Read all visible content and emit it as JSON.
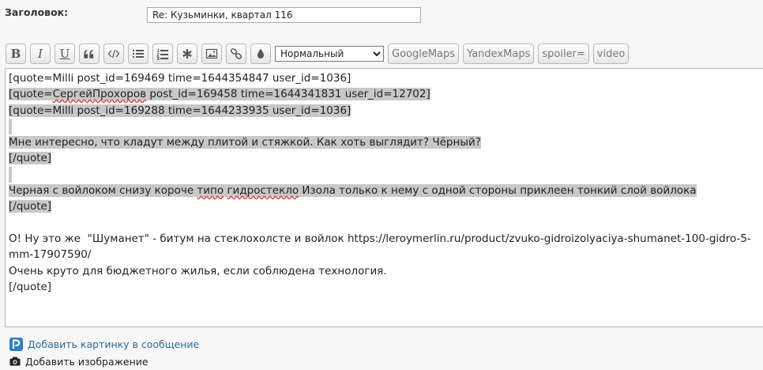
{
  "subject": {
    "label": "Заголовок:",
    "value": "Re: Кузьминки, квартал 116"
  },
  "toolbar": {
    "bold_label": "B",
    "italic_label": "I",
    "underline_label": "U",
    "quote_label": "❝",
    "code_icon": "code-icon",
    "font_select_value": "Нормальный",
    "googlemaps_label": "GoogleMaps",
    "yandexmaps_label": "YandexMaps",
    "spoiler_label": "spoiler=",
    "video_label": "video"
  },
  "editor": {
    "l1": "[quote=Milli post_id=169469 time=1644354847 user_id=1036]",
    "l2a": "[quote=",
    "l2b": "СергейПрохоров",
    "l2c": " post_id=169458 time=1644341831 user_id=12702]",
    "l3": "[quote=Milli post_id=169288 time=1644233935 user_id=1036]",
    "l5": "Мне интересно, что кладут между плитой и стяжкой. Как хоть выглядит? Чёрный?",
    "l6": "[/quote]",
    "l8a": "Черная с войлоком снизу короче ",
    "l8b": "типо",
    "l8c": " ",
    "l8d": "гидростекло",
    "l8e": " Изола только к нему с одной стороны приклеен тонкий слой войлока",
    "l9": "[/quote]",
    "l11": "О! Ну это же  \"Шуманет\" - битум на стеклохолсте и войлок https://leroymerlin.ru/product/zvuko-gidroizolyaciya-shumanet-100-gidro-5-mm-17907590/",
    "l12": "Очень круто для бюджетного жилья, если соблюдена технология.",
    "l13": "[/quote]"
  },
  "links": {
    "add_picture": "Добавить картинку в сообщение",
    "add_image": "Добавить изображение"
  }
}
